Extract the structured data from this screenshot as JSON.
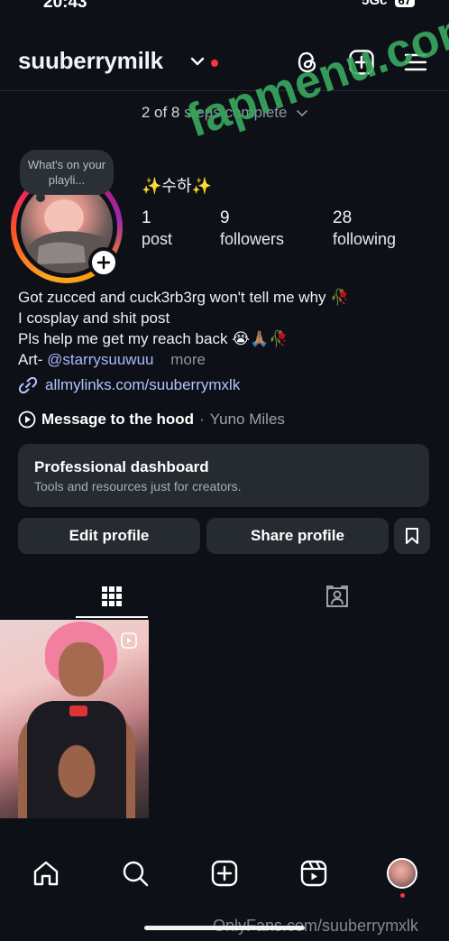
{
  "status_bar": {
    "time": "20:43",
    "network": "5Gc",
    "battery": "67"
  },
  "header": {
    "username": "suuberrymilk",
    "icons": {
      "dropdown": "chevron-down-icon",
      "threads": "threads-icon",
      "create": "plus-square-icon",
      "menu": "hamburger-menu-icon"
    }
  },
  "steps": {
    "count": "2 of 8",
    "label": "steps complete"
  },
  "watermark": "fapmenu.com",
  "profile": {
    "note": "What's on your playli...",
    "display_name": "✨수하✨",
    "stats": [
      {
        "value": "1",
        "label": "post"
      },
      {
        "value": "9",
        "label": "followers"
      },
      {
        "value": "28",
        "label": "following"
      }
    ]
  },
  "bio": {
    "line1": "Got zucced and cuck3rb3rg won't tell me why 🥀",
    "line2": "I cosplay and shit post",
    "line3": "Pls help me get my reach back 😭🙏🏽🥀",
    "art_prefix": "Art-",
    "art_mention": "@starrysuuwuu",
    "more": "more",
    "link": "allmylinks.com/suuberrymxlk",
    "music_title": "Message to the hood",
    "music_separator": "·",
    "music_artist": "Yuno Miles"
  },
  "pro_dashboard": {
    "title": "Professional dashboard",
    "subtitle": "Tools and resources just for creators."
  },
  "buttons": {
    "edit": "Edit profile",
    "share": "Share profile"
  },
  "tabs": [
    {
      "name": "grid",
      "icon": "grid-icon",
      "active": true
    },
    {
      "name": "tagged",
      "icon": "tagged-person-icon",
      "active": false
    }
  ],
  "nav": [
    "home-icon",
    "search-icon",
    "create-icon",
    "reels-icon",
    "profile-avatar"
  ],
  "footer_watermark": "OnlyFans.com/suuberrymxlk",
  "colors": {
    "background": "#0d1117",
    "accent_red": "#ff3040",
    "link": "#b3c2ff",
    "watermark_green": "#3aa85f"
  }
}
